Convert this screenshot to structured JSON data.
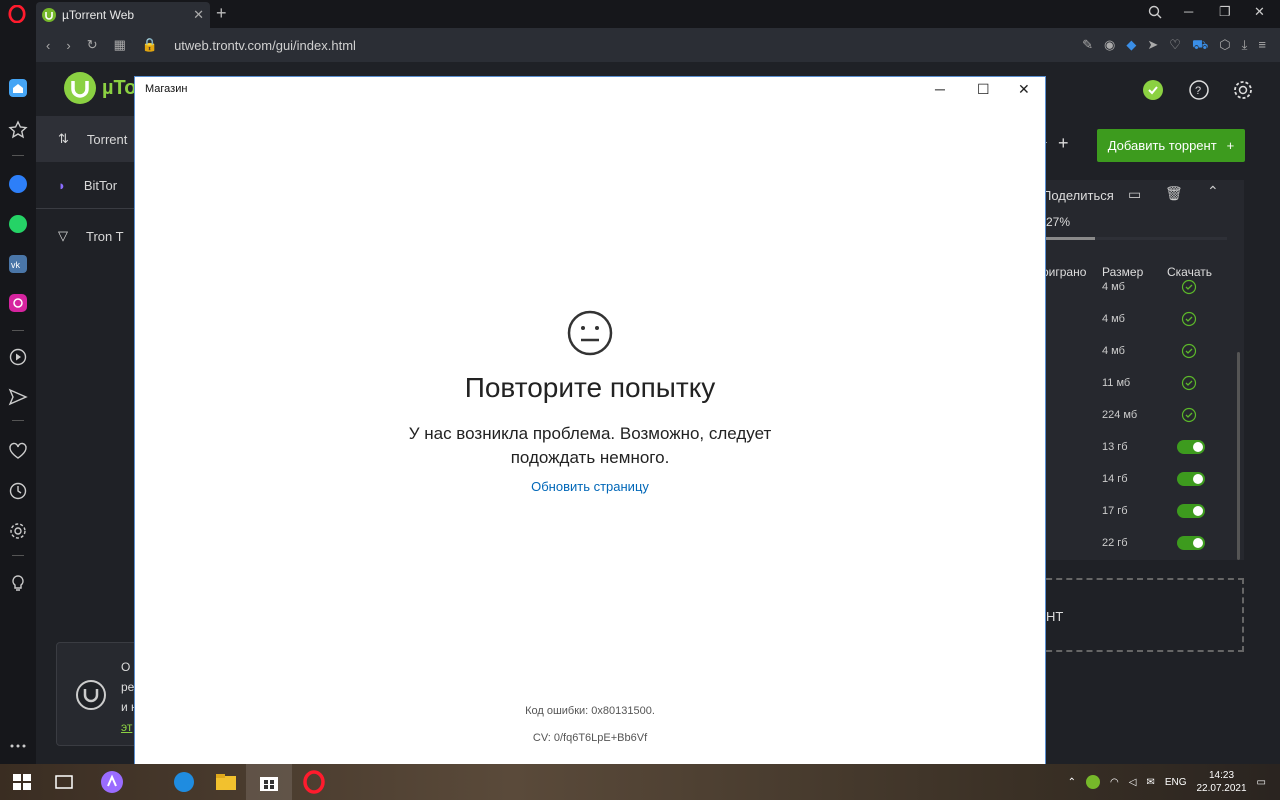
{
  "browser": {
    "tab_title": "µTorrent Web",
    "tab_close": "✕",
    "new_tab": "+",
    "url": "utweb.trontv.com/gui/index.html",
    "window_controls": [
      "─",
      "❐",
      "✕"
    ]
  },
  "utorrent": {
    "logo_text": "µTor",
    "nav": [
      {
        "label": "Torrent",
        "icon": "transfer-arrows-icon"
      },
      {
        "label": "BitTor",
        "icon": "speedometer-icon"
      },
      {
        "label": "Tron T",
        "icon": "tron-tv-icon"
      }
    ],
    "add_torrent_label": "Добавить торрент",
    "add_plus": "+",
    "right_stub_label": "т",
    "share_label": "Поделиться",
    "progress_text": "27%",
    "progress_fraction": 0.27,
    "columns": {
      "played": "оиграно",
      "size": "Размер",
      "download": "Скачать"
    },
    "rows": [
      {
        "size": "4 мб",
        "state": "done"
      },
      {
        "size": "4 мб",
        "state": "done"
      },
      {
        "size": "4 мб",
        "state": "done"
      },
      {
        "size": "11 мб",
        "state": "done"
      },
      {
        "size": "224 мб",
        "state": "done"
      },
      {
        "size": "13 гб",
        "state": "toggle"
      },
      {
        "size": "14 гб",
        "state": "toggle"
      },
      {
        "size": "17 гб",
        "state": "toggle"
      },
      {
        "size": "22 гб",
        "state": "toggle"
      }
    ],
    "drop_text": "НТ",
    "promo": {
      "line1": "О",
      "line2": "ре",
      "line3": "и н",
      "link": "эт"
    }
  },
  "store": {
    "title": "Магазин",
    "controls": [
      "─",
      "☐",
      "✕"
    ],
    "error_title": "Повторите попытку",
    "error_message": "У нас возникла проблема. Возможно, следует подождать немного.",
    "refresh_link": "Обновить страницу",
    "error_code": "Код ошибки: 0x80131500.",
    "cv": "CV: 0/fq6T6LpE+Bb6Vf"
  },
  "taskbar": {
    "lang": "ENG",
    "time": "14:23",
    "date": "22.07.2021"
  },
  "colors": {
    "accent_green": "#3d9b1e",
    "link_blue": "#0067b8",
    "dialog_border": "#5a8fd0"
  }
}
